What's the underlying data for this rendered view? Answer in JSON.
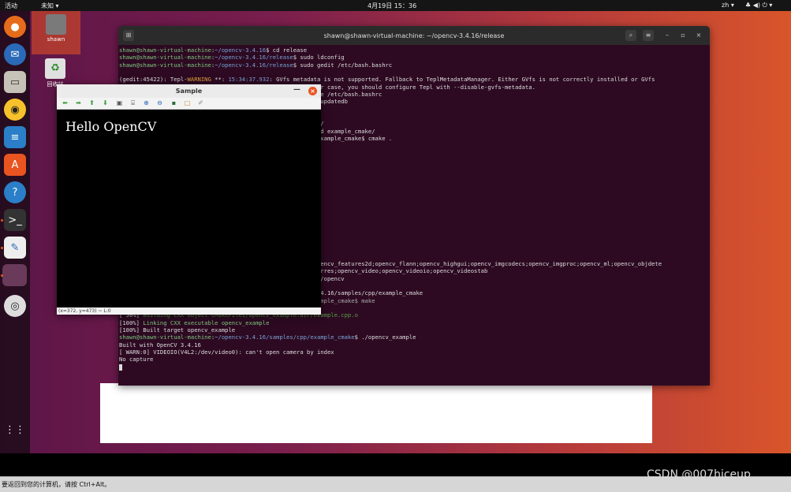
{
  "topbar": {
    "activities": "活动",
    "app_menu": "未知 ▾",
    "clock": "4月19日 15：36",
    "input_method": "zh ▾",
    "system_icons": "♣ ◀) ⏻ ▾"
  },
  "desktop_icons": [
    {
      "label": "shawn"
    },
    {
      "label": "回收站"
    }
  ],
  "terminal": {
    "title": "shawn@shawn-virtual-machine: ~/opencv-3.4.16/release",
    "lines": [
      [
        {
          "c": "green",
          "t": "shawn@shawn-virtual-machine"
        },
        {
          "c": "",
          "t": ":"
        },
        {
          "c": "blue",
          "t": "~/opencv-3.4.16"
        },
        {
          "c": "",
          "t": "$ cd release"
        }
      ],
      [
        {
          "c": "green",
          "t": "shawn@shawn-virtual-machine"
        },
        {
          "c": "",
          "t": ":"
        },
        {
          "c": "blue",
          "t": "~/opencv-3.4.16/release"
        },
        {
          "c": "",
          "t": "$ sudo ldconfig"
        }
      ],
      [
        {
          "c": "green",
          "t": "shawn@shawn-virtual-machine"
        },
        {
          "c": "",
          "t": ":"
        },
        {
          "c": "blue",
          "t": "~/opencv-3.4.16/release"
        },
        {
          "c": "",
          "t": "$ sudo gedit /etc/bash.bashrc"
        }
      ],
      [
        {
          "c": "",
          "t": ""
        }
      ],
      [
        {
          "c": "",
          "t": "(gedit:45422): Tepl-"
        },
        {
          "c": "warn",
          "t": "WARNING"
        },
        {
          "c": "",
          "t": " **: "
        },
        {
          "c": "blue",
          "t": "15:34:37.932"
        },
        {
          "c": "",
          "t": ": GVfs metadata is not supported. Fallback to TeplMetadataManager. Either GVfs is not correctly installed or GVfs"
        }
      ],
      [
        {
          "c": "",
          "t": "                                                        tter case, you should configure Tepl with --disable-gvfs-metadata."
        }
      ],
      [
        {
          "c": "",
          "t": "                                                        urce /etc/bash.bashrc"
        }
      ],
      [
        {
          "c": "",
          "t": "                                                        do updatedb"
        }
      ],
      [
        {
          "c": "",
          "t": "                                                        .."
        }
      ],
      [
        {
          "c": "",
          "t": "                                                        /"
        }
      ],
      [
        {
          "c": "",
          "t": "                                                        cpp/"
        }
      ],
      [
        {
          "c": "",
          "t": "                                                        $ cd example_cmake/"
        }
      ],
      [
        {
          "c": "",
          "t": "                                                        s/example_cmake$ cmake ."
        }
      ],
      [
        {
          "c": "",
          "t": ""
        }
      ],
      [
        {
          "c": "",
          "t": ""
        }
      ],
      [
        {
          "c": "",
          "t": ""
        }
      ],
      [
        {
          "c": "",
          "t": ""
        }
      ],
      [
        {
          "c": "",
          "t": ""
        }
      ],
      [
        {
          "c": "",
          "t": ""
        }
      ],
      [
        {
          "c": "",
          "t": ""
        }
      ],
      [
        {
          "c": "",
          "t": ""
        }
      ],
      [
        {
          "c": "",
          "t": "                                                        cs"
        }
      ],
      [
        {
          "c": "",
          "t": ""
        }
      ],
      [
        {
          "c": "",
          "t": ""
        }
      ],
      [
        {
          "c": "",
          "t": ""
        }
      ],
      [
        {
          "c": "",
          "t": ""
        }
      ],
      [
        {
          "c": "",
          "t": ""
        }
      ],
      [
        {
          "c": "",
          "t": ""
        }
      ],
      [
        {
          "c": "",
          "t": ""
        }
      ],
      [
        {
          "c": "",
          "t": "                                                        ;opencv_features2d;opencv_flann;opencv_highgui;opencv_imgcodecs;opencv_imgproc;opencv_ml;opencv_objdete"
        }
      ],
      [
        {
          "c": "",
          "t": "                                                        uperres;opencv_video;opencv_videoio;opencv_videostab"
        }
      ],
      [
        {
          "c": "",
          "t": "                                                        ude/opencv"
        }
      ],
      [
        {
          "c": "",
          "t": ""
        }
      ],
      [
        {
          "c": "",
          "t": "                                                        -3.4.16/samples/cpp/example_cmake"
        }
      ],
      [
        {
          "c": "gray",
          "t": "shawn@shawn-virtual-machine:~/opencv-3.4.16/samples/cpp/example_cmake$ make"
        }
      ],
      [
        {
          "c": "dgreen",
          "t": "Scanning dependencies of target opencv_example"
        }
      ],
      [
        {
          "c": "",
          "t": "[ 50%] "
        },
        {
          "c": "dgreen",
          "t": "Building CXX object CMakeFiles/opencv_example.dir/example.cpp.o"
        }
      ],
      [
        {
          "c": "",
          "t": "[100%] "
        },
        {
          "c": "green",
          "t": "Linking CXX executable opencv_example"
        }
      ],
      [
        {
          "c": "",
          "t": "[100%] Built target opencv_example"
        }
      ],
      [
        {
          "c": "green",
          "t": "shawn@shawn-virtual-machine"
        },
        {
          "c": "",
          "t": ":"
        },
        {
          "c": "blue",
          "t": "~/opencv-3.4.16/samples/cpp/example_cmake"
        },
        {
          "c": "",
          "t": "$ ./opencv_example"
        }
      ],
      [
        {
          "c": "",
          "t": "Built with OpenCV 3.4.16"
        }
      ],
      [
        {
          "c": "",
          "t": "[ WARN:0] VIDEOIO(V4L2:/dev/video0): can't open camera by index"
        }
      ],
      [
        {
          "c": "",
          "t": "No capture"
        }
      ]
    ]
  },
  "sample_window": {
    "title": "Sample",
    "canvas_text": "Hello OpenCV",
    "status": "(x=372, y=473) ~ L:0",
    "close_symbol": "×",
    "minimize_symbol": "—"
  },
  "bottombar": {
    "hint": "要返回到您的计算机，请按 Ctrl+Alt。"
  },
  "watermark": "CSDN @007hiceup"
}
